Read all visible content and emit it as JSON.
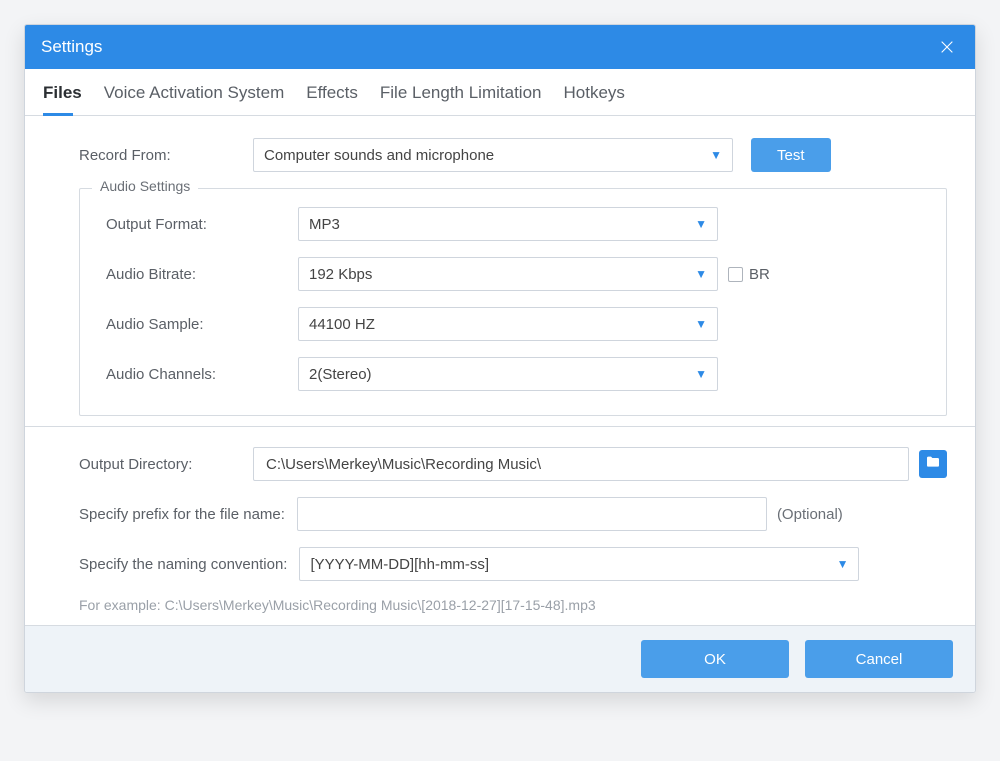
{
  "window": {
    "title": "Settings"
  },
  "tabs": {
    "files": "Files",
    "vas": "Voice Activation System",
    "effects": "Effects",
    "fll": "File Length Limitation",
    "hotkeys": "Hotkeys",
    "active": "files"
  },
  "record": {
    "label": "Record  From:",
    "value": "Computer sounds and microphone",
    "test": "Test"
  },
  "audio": {
    "legend": "Audio Settings",
    "output_format": {
      "label": "Output Format:",
      "value": "MP3"
    },
    "bitrate": {
      "label": "Audio Bitrate:",
      "value": "192 Kbps",
      "br_label": "BR"
    },
    "sample": {
      "label": "Audio Sample:",
      "value": "44100 HZ"
    },
    "channels": {
      "label": "Audio Channels:",
      "value": "2(Stereo)"
    }
  },
  "output": {
    "dir_label": "Output Directory:",
    "dir_value": "C:\\Users\\Merkey\\Music\\Recording Music\\",
    "prefix_label": "Specify prefix for the file name:",
    "prefix_value": "",
    "optional": "(Optional)",
    "naming_label": "Specify the naming convention:",
    "naming_value": "[YYYY-MM-DD][hh-mm-ss]",
    "example": "For example: C:\\Users\\Merkey\\Music\\Recording Music\\[2018-12-27][17-15-48].mp3"
  },
  "footer": {
    "ok": "OK",
    "cancel": "Cancel"
  }
}
